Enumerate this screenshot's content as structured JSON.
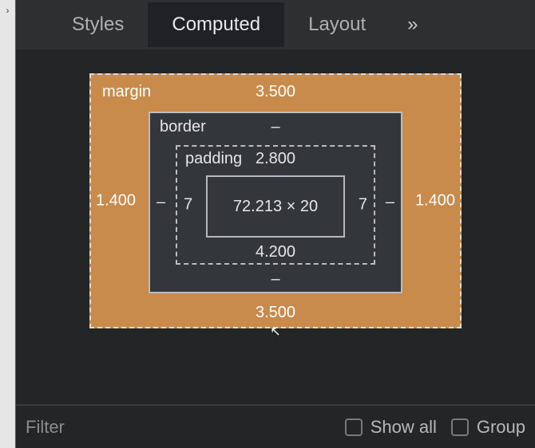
{
  "tabs": {
    "styles": "Styles",
    "computed": "Computed",
    "layout": "Layout",
    "overflow_glyph": "»"
  },
  "box_model": {
    "margin": {
      "label": "margin",
      "top": "3.500",
      "right": "1.400",
      "bottom": "3.500",
      "left": "1.400"
    },
    "border": {
      "label": "border",
      "top": "–",
      "right": "–",
      "bottom": "–",
      "left": "–"
    },
    "padding": {
      "label": "padding",
      "top": "2.800",
      "right": "7",
      "bottom": "4.200",
      "left": "7"
    },
    "content": "72.213 × 20"
  },
  "filter": {
    "placeholder": "Filter",
    "show_all": "Show all",
    "group": "Group"
  },
  "cursor_glyph": "↖"
}
